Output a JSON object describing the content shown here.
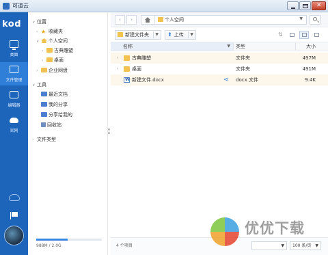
{
  "window": {
    "title": "可道云"
  },
  "rail": {
    "logo": "kod",
    "items": [
      {
        "label": "桌面",
        "icon": "monitor-icon"
      },
      {
        "label": "文件管理",
        "icon": "folder-icon",
        "active": true
      },
      {
        "label": "编辑器",
        "icon": "edit-icon"
      },
      {
        "label": "官网",
        "icon": "cloud-icon"
      }
    ]
  },
  "tree": {
    "location_label": "位置",
    "favorites": "收藏夹",
    "personal_space": "个人空间",
    "sub_folders": [
      "古典雕塑",
      "桌面"
    ],
    "enterprise_disk": "企业网盘",
    "tools_label": "工具",
    "tools": [
      "最近文档",
      "我的分享",
      "分享给我的",
      "回收站"
    ],
    "file_types": "文件类型",
    "storage_text": "988M / 2.0G",
    "storage_used_fraction": 0.48
  },
  "address": {
    "crumb": "个人空间"
  },
  "toolbar": {
    "new_folder": "新建文件夹",
    "upload": "上传"
  },
  "columns": {
    "name": "名称",
    "type": "类型",
    "size": "大小"
  },
  "files": [
    {
      "name": "古典雕塑",
      "type": "文件夹",
      "size": "497M",
      "kind": "folder"
    },
    {
      "name": "桌面",
      "type": "文件夹",
      "size": "491M",
      "kind": "folder"
    },
    {
      "name": "新建文件.docx",
      "type": "docx 文件",
      "size": "9.4K",
      "kind": "docx",
      "shared": true
    }
  ],
  "status": {
    "count": "4 个项目",
    "page_size_option": "100 条/页"
  },
  "watermark": {
    "text": "优优下载"
  },
  "colors": {
    "rail_blue": "#1d65bb",
    "active_blue": "#2f7fd8",
    "folder_yellow": "#f2c250",
    "accent_blue": "#3a86e0"
  }
}
